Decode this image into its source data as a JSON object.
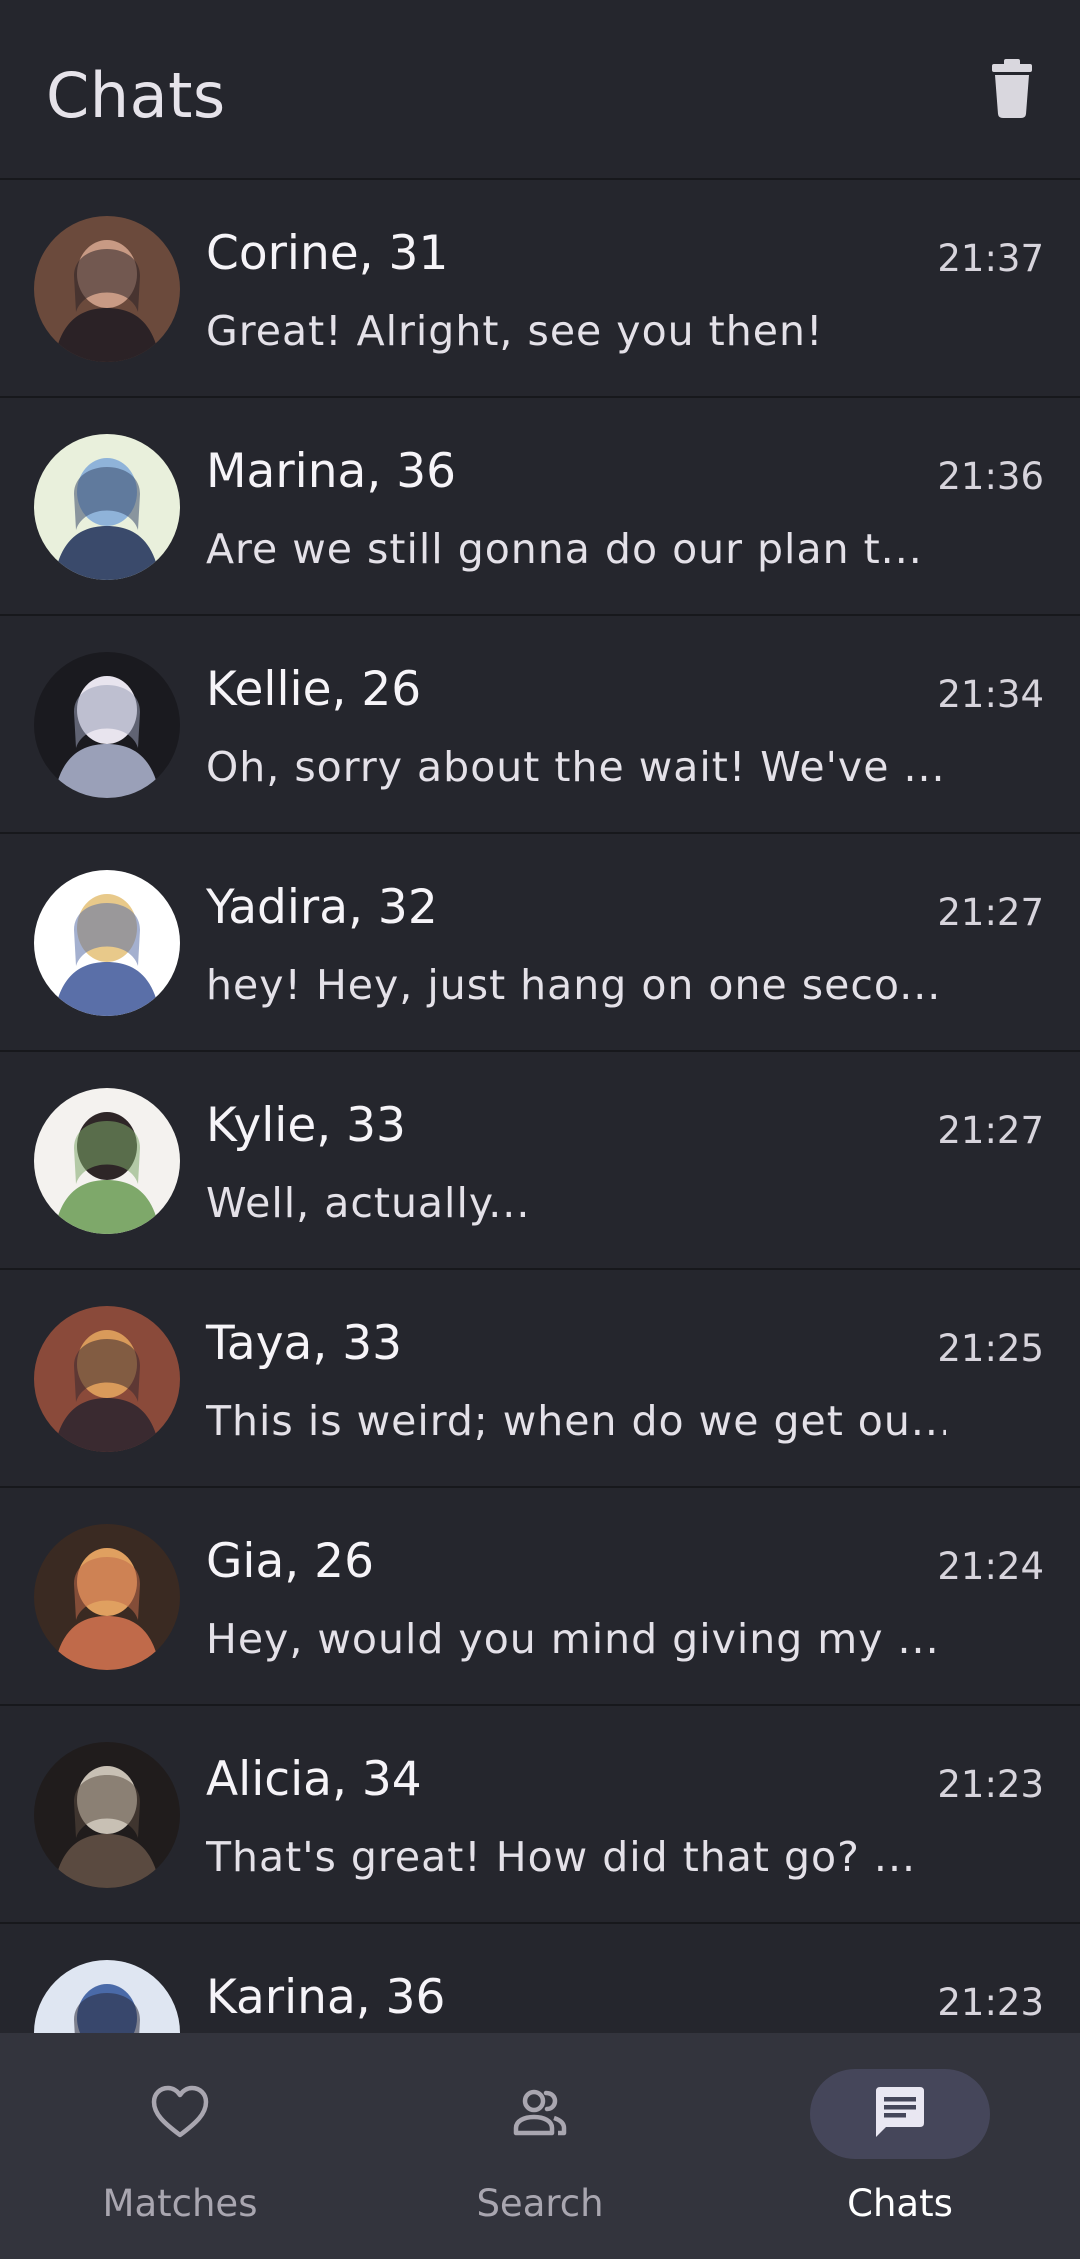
{
  "header": {
    "title": "Chats",
    "delete_icon": "trash-icon"
  },
  "chats": [
    {
      "name": "Corine, 31",
      "time": "21:37",
      "message": "Great! Alright, see you then!",
      "avatar_colors": [
        "#6b4a3c",
        "#c89a84",
        "#2b2226"
      ]
    },
    {
      "name": "Marina, 36",
      "time": "21:36",
      "message": "Are we still gonna do our plan t...",
      "avatar_colors": [
        "#e9f0dc",
        "#8fb3d9",
        "#3a4a6b"
      ]
    },
    {
      "name": "Kellie, 26",
      "time": "21:34",
      "message": "Oh, sorry about the wait! We've ...",
      "avatar_colors": [
        "#1a1a1f",
        "#e8e4ee",
        "#9aa0b8"
      ]
    },
    {
      "name": "Yadira, 32",
      "time": "21:27",
      "message": "hey! Hey, just hang on one seco...",
      "avatar_colors": [
        "#ffffff",
        "#e8c98a",
        "#5a6fa8"
      ]
    },
    {
      "name": "Kylie, 33",
      "time": "21:27",
      "message": "Well, actually...",
      "avatar_colors": [
        "#f4f2ef",
        "#2e2627",
        "#7ea86a"
      ]
    },
    {
      "name": "Taya, 33",
      "time": "21:25",
      "message": "This is weird; when do we get ou...",
      "avatar_colors": [
        "#8a4a3a",
        "#d99a5a",
        "#3a2a30"
      ]
    },
    {
      "name": "Gia, 26",
      "time": "21:24",
      "message": "Hey, would you mind giving my ...",
      "avatar_colors": [
        "#3a2a22",
        "#e0a060",
        "#c06a4a"
      ]
    },
    {
      "name": "Alicia, 34",
      "time": "21:23",
      "message": "That's great! How did that go? ...",
      "avatar_colors": [
        "#201c1c",
        "#c8c0b4",
        "#5a4a40"
      ]
    },
    {
      "name": "Karina, 36",
      "time": "21:23",
      "message": "",
      "avatar_colors": [
        "#dfe6f2",
        "#4a6aa8",
        "#2a2a3a"
      ]
    }
  ],
  "nav": {
    "items": [
      {
        "label": "Matches",
        "icon": "heart-icon",
        "active": false
      },
      {
        "label": "Search",
        "icon": "people-icon",
        "active": false
      },
      {
        "label": "Chats",
        "icon": "chat-icon",
        "active": true
      }
    ]
  }
}
